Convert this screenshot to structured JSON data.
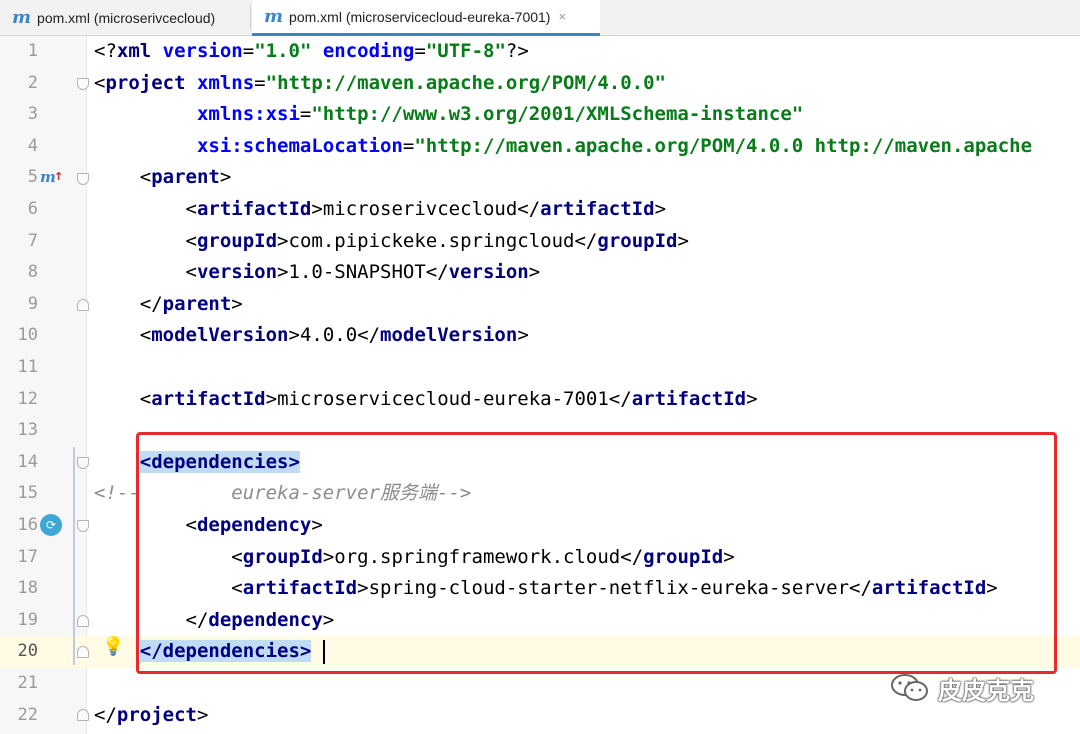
{
  "tabs": [
    {
      "label": "pom.xml (microserivcecloud)",
      "icon": "maven-m-icon"
    },
    {
      "label": "pom.xml (microservicecloud-eureka-7001)",
      "icon": "maven-m-icon",
      "active": true
    }
  ],
  "tab_close_glyph": "×",
  "maven_glyph": "m",
  "editor": {
    "caret_line": 20,
    "lines": [
      {
        "num": "1",
        "tokens": [
          [
            "bracket",
            "<?"
          ],
          [
            "tag",
            "xml "
          ],
          [
            "attr",
            "version"
          ],
          [
            "text",
            "="
          ],
          [
            "val",
            "\"1.0\""
          ],
          [
            "text",
            " "
          ],
          [
            "attr",
            "encoding"
          ],
          [
            "text",
            "="
          ],
          [
            "val",
            "\"UTF-8\""
          ],
          [
            "bracket",
            "?>"
          ]
        ]
      },
      {
        "num": "2",
        "tokens": [
          [
            "bracket",
            "<"
          ],
          [
            "tag",
            "project "
          ],
          [
            "attr",
            "xmlns"
          ],
          [
            "text",
            "="
          ],
          [
            "val",
            "\"http://maven.apache.org/POM/4.0.0\""
          ]
        ]
      },
      {
        "num": "3",
        "tokens": [
          [
            "text",
            "         "
          ],
          [
            "attr",
            "xmlns:xsi"
          ],
          [
            "text",
            "="
          ],
          [
            "val",
            "\"http://www.w3.org/2001/XMLSchema-instance\""
          ]
        ]
      },
      {
        "num": "4",
        "tokens": [
          [
            "text",
            "         "
          ],
          [
            "attr",
            "xsi:schemaLocation"
          ],
          [
            "text",
            "="
          ],
          [
            "val",
            "\"http://maven.apache.org/POM/4.0.0 http://maven.apache"
          ]
        ]
      },
      {
        "num": "5",
        "tokens": [
          [
            "text",
            "    "
          ],
          [
            "bracket",
            "<"
          ],
          [
            "tag",
            "parent"
          ],
          [
            "bracket",
            ">"
          ]
        ]
      },
      {
        "num": "6",
        "tokens": [
          [
            "text",
            "        "
          ],
          [
            "bracket",
            "<"
          ],
          [
            "tag",
            "artifactId"
          ],
          [
            "bracket",
            ">"
          ],
          [
            "text",
            "microserivcecloud"
          ],
          [
            "bracket",
            "</"
          ],
          [
            "tag",
            "artifactId"
          ],
          [
            "bracket",
            ">"
          ]
        ]
      },
      {
        "num": "7",
        "tokens": [
          [
            "text",
            "        "
          ],
          [
            "bracket",
            "<"
          ],
          [
            "tag",
            "groupId"
          ],
          [
            "bracket",
            ">"
          ],
          [
            "text",
            "com.pipickeke.springcloud"
          ],
          [
            "bracket",
            "</"
          ],
          [
            "tag",
            "groupId"
          ],
          [
            "bracket",
            ">"
          ]
        ]
      },
      {
        "num": "8",
        "tokens": [
          [
            "text",
            "        "
          ],
          [
            "bracket",
            "<"
          ],
          [
            "tag",
            "version"
          ],
          [
            "bracket",
            ">"
          ],
          [
            "text",
            "1.0-SNAPSHOT"
          ],
          [
            "bracket",
            "</"
          ],
          [
            "tag",
            "version"
          ],
          [
            "bracket",
            ">"
          ]
        ]
      },
      {
        "num": "9",
        "tokens": [
          [
            "text",
            "    "
          ],
          [
            "bracket",
            "</"
          ],
          [
            "tag",
            "parent"
          ],
          [
            "bracket",
            ">"
          ]
        ]
      },
      {
        "num": "10",
        "tokens": [
          [
            "text",
            "    "
          ],
          [
            "bracket",
            "<"
          ],
          [
            "tag",
            "modelVersion"
          ],
          [
            "bracket",
            ">"
          ],
          [
            "text",
            "4.0.0"
          ],
          [
            "bracket",
            "</"
          ],
          [
            "tag",
            "modelVersion"
          ],
          [
            "bracket",
            ">"
          ]
        ]
      },
      {
        "num": "11",
        "tokens": []
      },
      {
        "num": "12",
        "tokens": [
          [
            "text",
            "    "
          ],
          [
            "bracket",
            "<"
          ],
          [
            "tag",
            "artifactId"
          ],
          [
            "bracket",
            ">"
          ],
          [
            "text",
            "microservicecloud-eureka-7001"
          ],
          [
            "bracket",
            "</"
          ],
          [
            "tag",
            "artifactId"
          ],
          [
            "bracket",
            ">"
          ]
        ]
      },
      {
        "num": "13",
        "tokens": []
      },
      {
        "num": "14",
        "tokens": [
          [
            "text",
            "    "
          ],
          [
            "hl",
            "<dependencies>"
          ]
        ]
      },
      {
        "num": "15",
        "tokens": [
          [
            "comment",
            "<!--        eureka-server服务端-->"
          ]
        ]
      },
      {
        "num": "16",
        "tokens": [
          [
            "text",
            "        "
          ],
          [
            "bracket",
            "<"
          ],
          [
            "tag",
            "dependency"
          ],
          [
            "bracket",
            ">"
          ]
        ]
      },
      {
        "num": "17",
        "tokens": [
          [
            "text",
            "            "
          ],
          [
            "bracket",
            "<"
          ],
          [
            "tag",
            "groupId"
          ],
          [
            "bracket",
            ">"
          ],
          [
            "text",
            "org.springframework.cloud"
          ],
          [
            "bracket",
            "</"
          ],
          [
            "tag",
            "groupId"
          ],
          [
            "bracket",
            ">"
          ]
        ]
      },
      {
        "num": "18",
        "tokens": [
          [
            "text",
            "            "
          ],
          [
            "bracket",
            "<"
          ],
          [
            "tag",
            "artifactId"
          ],
          [
            "bracket",
            ">"
          ],
          [
            "text",
            "spring-cloud-starter-netflix-eureka-server"
          ],
          [
            "bracket",
            "</"
          ],
          [
            "tag",
            "artifactId"
          ],
          [
            "bracket",
            ">"
          ]
        ]
      },
      {
        "num": "19",
        "tokens": [
          [
            "text",
            "        "
          ],
          [
            "bracket",
            "</"
          ],
          [
            "tag",
            "dependency"
          ],
          [
            "bracket",
            ">"
          ]
        ]
      },
      {
        "num": "20",
        "tokens": [
          [
            "text",
            "    "
          ],
          [
            "hl",
            "</dependencies>"
          ]
        ]
      },
      {
        "num": "21",
        "tokens": []
      },
      {
        "num": "22",
        "tokens": [
          [
            "bracket",
            "</"
          ],
          [
            "tag",
            "project"
          ],
          [
            "bracket",
            ">"
          ]
        ]
      }
    ]
  },
  "watermark": {
    "text": "皮皮克克",
    "icon": "wechat-icon"
  },
  "colors": {
    "annotation_box": "#ea2a2a",
    "tag": "#000080",
    "attribute": "#0000ff",
    "string": "#067d17",
    "comment": "#8c8c8c",
    "highlight": "#c0dcf5"
  }
}
